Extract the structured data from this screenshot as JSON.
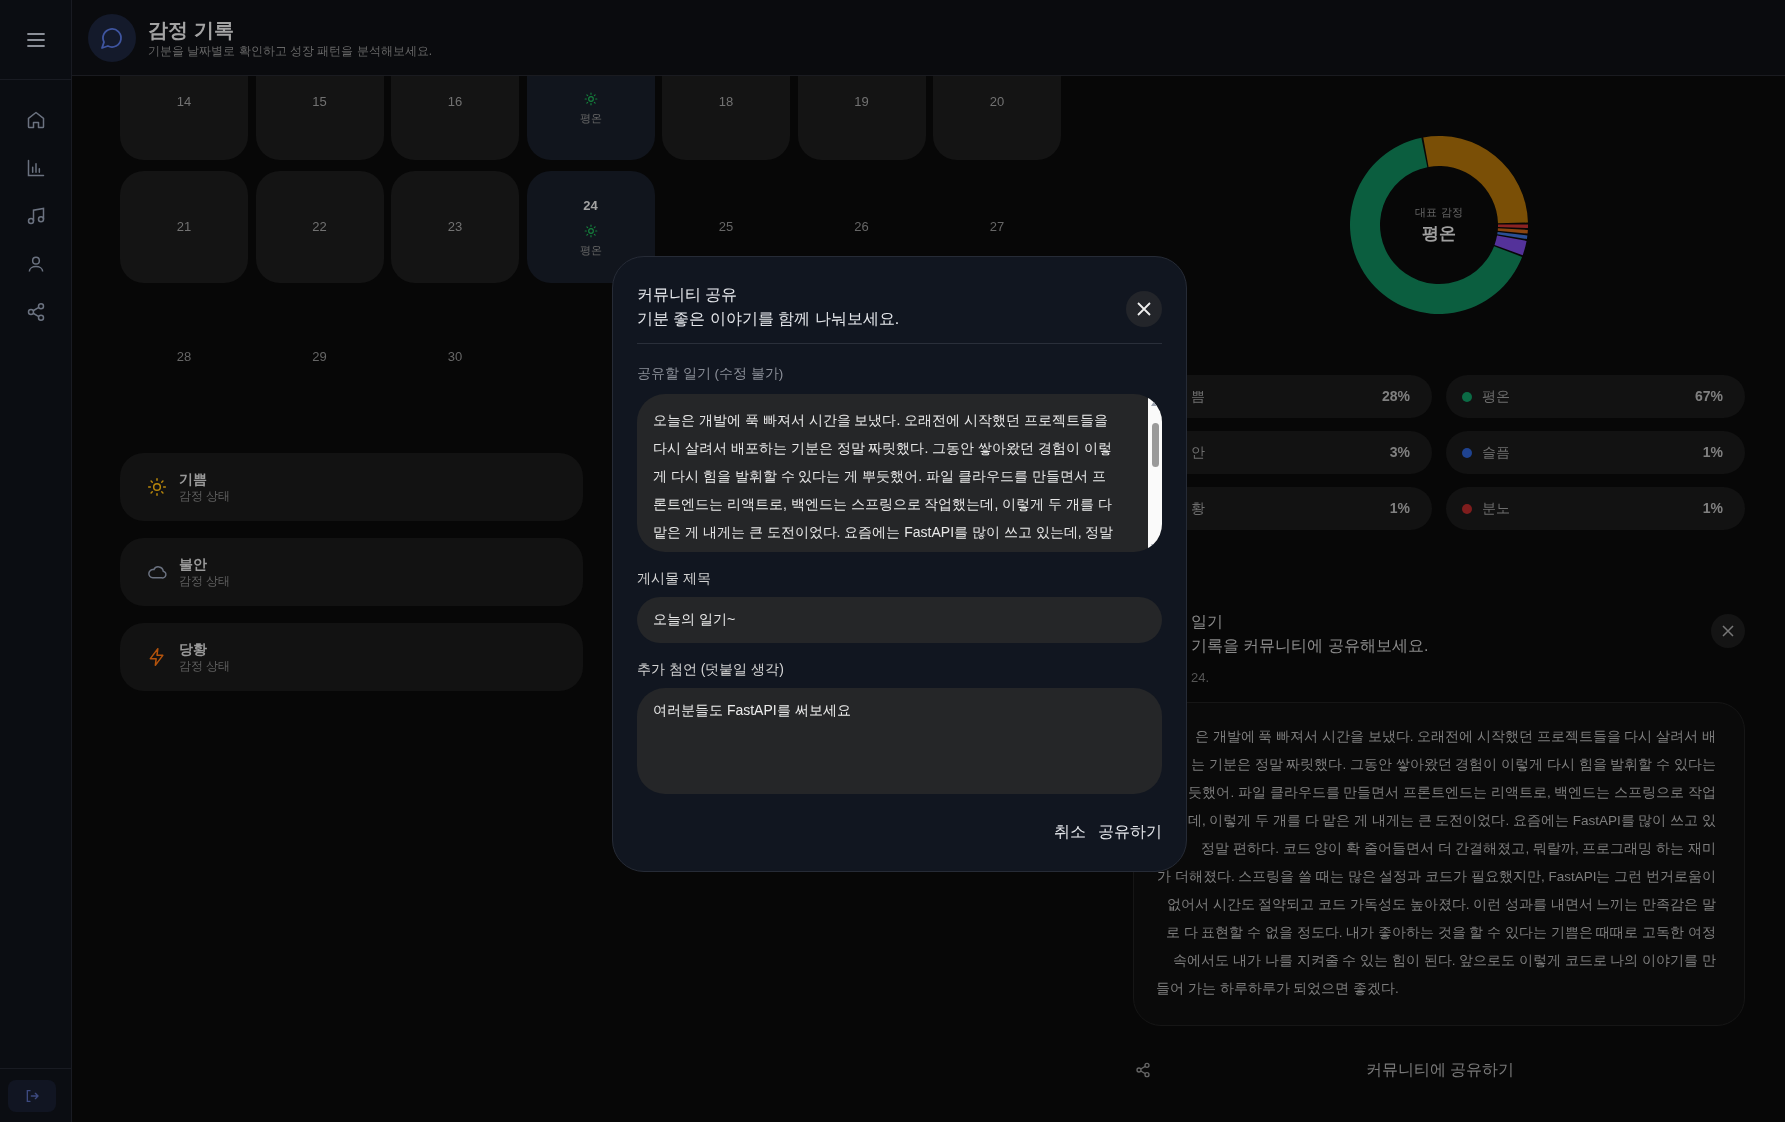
{
  "header": {
    "title": "감정 기록",
    "subtitle": "기분을 날짜별로 확인하고 성장 패턴을 분석해보세요."
  },
  "calendar": {
    "days": [
      {
        "day": "14",
        "future": false,
        "today": false
      },
      {
        "day": "15",
        "future": false,
        "today": false
      },
      {
        "day": "16",
        "future": false,
        "today": false
      },
      {
        "future": false,
        "today": false,
        "mood": {
          "kind": "calm",
          "label": "평온"
        }
      },
      {
        "day": "18",
        "future": false,
        "today": false
      },
      {
        "day": "19",
        "future": false,
        "today": false
      },
      {
        "day": "20",
        "future": false,
        "today": false
      },
      {
        "day": "21",
        "future": false,
        "today": false
      },
      {
        "day": "22",
        "future": false,
        "today": false
      },
      {
        "day": "23",
        "future": false,
        "today": false
      },
      {
        "day": "24",
        "future": false,
        "today": true,
        "mood": {
          "kind": "calm",
          "label": "평온"
        }
      },
      {
        "day": "25",
        "future": true,
        "today": false
      },
      {
        "day": "26",
        "future": true,
        "today": false
      },
      {
        "day": "27",
        "future": true,
        "today": false
      },
      {
        "day": "28",
        "future": true,
        "today": false
      },
      {
        "day": "29",
        "future": true,
        "today": false
      },
      {
        "day": "30",
        "future": true,
        "today": false
      }
    ]
  },
  "emotion_cards": [
    {
      "kind": "sun",
      "label": "기쁨",
      "caption": "감정 상태"
    },
    {
      "kind": "cloud",
      "label": "불안",
      "caption": "감정 상태"
    },
    {
      "kind": "bolt",
      "label": "당황",
      "caption": "감정 상태"
    }
  ],
  "summary": {
    "caption": "대표 감정",
    "label": "평온",
    "chart_data": {
      "type": "donut",
      "values": [
        28,
        1,
        1,
        1,
        3,
        67
      ],
      "colors": [
        "#7a4f06",
        "#8b2323",
        "#8a4510",
        "#2b4f94",
        "#54329a",
        "#0b5e3f"
      ]
    }
  },
  "stats": [
    {
      "label": "쁨",
      "value": "28%"
    },
    {
      "label": "평온",
      "value": "67%",
      "color": "#0b6b45"
    },
    {
      "label": "안",
      "value": "3%"
    },
    {
      "label": "슬픔",
      "value": "1%",
      "color": "#1f4390"
    },
    {
      "label": "황",
      "value": "1%"
    },
    {
      "label": "분노",
      "value": "1%",
      "color": "#7f1d1d"
    }
  ],
  "diary": {
    "title": "일기",
    "subtitle": "기록을 커뮤니티에 공유해보세요.",
    "date": "24.",
    "lines": [
      "은 개발에 푹 빠져서 시간을 보냈다. 오래전에 시작했던 프로젝트들을 다시 살려서 배",
      "는 기분은 정말 짜릿했다. 그동안 쌓아왔던 경험이 이렇게 다시 힘을 발휘할 수 있다는",
      "듯했어. 파일 클라우드를 만들면서 프론트엔드는 리액트로, 백엔드는 스프링으로 작업",
      "데, 이렇게 두 개를 다 맡은 게 내게는 큰 도전이었다. 요즘에는 FastAPI를 많이 쓰고 있",
      "정말 편하다. 코드 양이 확 줄어들면서 더 간결해졌고, 뭐랄까, 프로그래밍 하는 재미",
      "가 더해졌다. 스프링을 쓸 때는 많은 설정과 코드가 필요했지만, FastAPI는 그런 번거로움이",
      "없어서 시간도 절약되고 코드 가독성도 높아졌다. 이런 성과를 내면서 느끼는 만족감은 말",
      "로 다 표현할 수 없을 정도다. 내가 좋아하는 것을 할 수 있다는 기쁨은 때때로 고독한 여정",
      "속에서도 내가 나를 지켜줄 수 있는 힘이 된다. 앞으로도 이렇게 코드로 나의 이야기를 만",
      "들어 가는 하루하루가 되었으면 좋겠다."
    ]
  },
  "share_button": {
    "label": "커뮤니티에 공유하기"
  },
  "modal": {
    "title": "커뮤니티 공유",
    "subtitle": "기분 좋은 이야기를 함께 나눠보세요.",
    "diary_label": "공유할 일기 (수정 불가)",
    "diary_lines": [
      "오늘은 개발에 푹 빠져서 시간을 보냈다. 오래전에 시작했던 프로젝트들을",
      "다시 살려서 배포하는 기분은 정말 짜릿했다. 그동안 쌓아왔던 경험이 이렇",
      "게 다시 힘을 발휘할 수 있다는 게 뿌듯했어. 파일 클라우드를 만들면서 프",
      "론트엔드는 리액트로, 백엔드는 스프링으로 작업했는데, 이렇게 두 개를 다",
      "맡은 게 내게는 큰 도전이었다. 요즘에는 FastAPI를 많이 쓰고 있는데, 정말"
    ],
    "title_label": "게시물 제목",
    "title_value": "오늘의 일기~",
    "note_label": "추가 첨언 (덧붙일 생각)",
    "note_value": "여러분들도 FastAPI를 써보세요",
    "buttons": [
      "취소",
      "공유하기"
    ]
  }
}
